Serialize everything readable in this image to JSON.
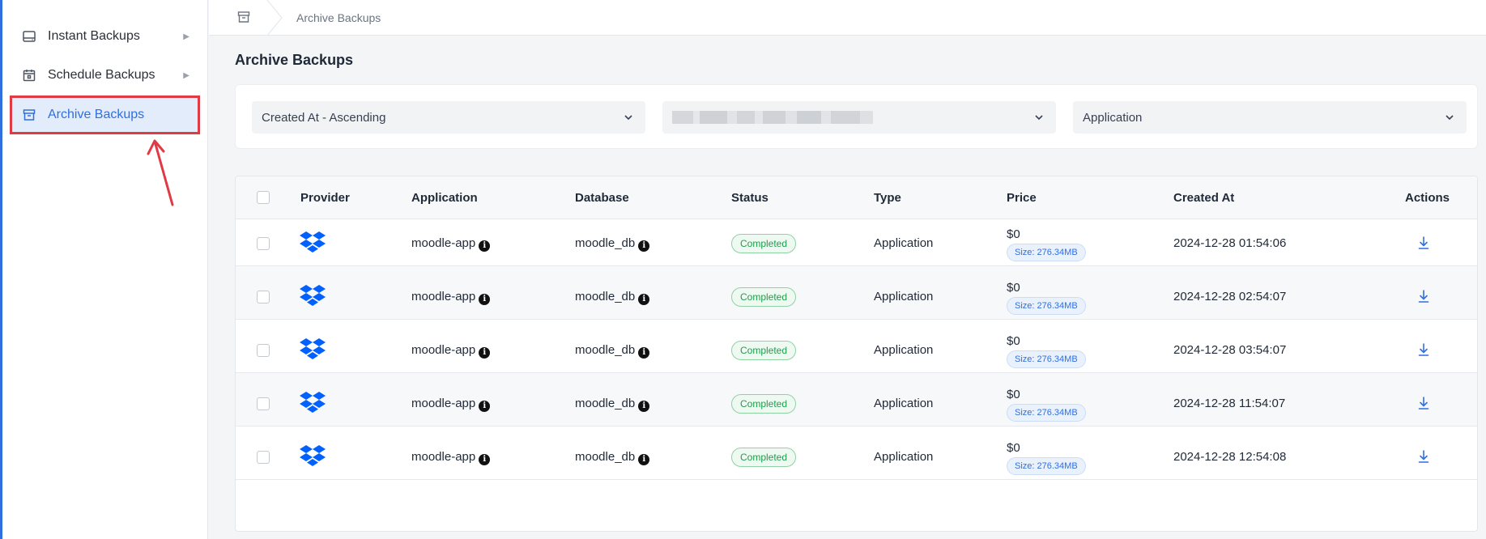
{
  "sidebar": {
    "items": [
      {
        "label": "Instant Backups",
        "icon": "drive-icon",
        "active": false
      },
      {
        "label": "Schedule Backups",
        "icon": "calendar-icon",
        "active": false
      },
      {
        "label": "Archive Backups",
        "icon": "archive-icon",
        "active": true
      }
    ]
  },
  "breadcrumb": {
    "current": "Archive Backups"
  },
  "page": {
    "title": "Archive Backups"
  },
  "filters": {
    "sort": "Created At - Ascending",
    "server": "",
    "type": "Application"
  },
  "table": {
    "columns": [
      "Provider",
      "Application",
      "Database",
      "Status",
      "Type",
      "Price",
      "Created At",
      "Actions"
    ],
    "rows": [
      {
        "provider": "dropbox-icon",
        "application": "moodle-app",
        "database": "moodle_db",
        "status": "Completed",
        "type": "Application",
        "price": "$0",
        "size": "Size: 276.34MB",
        "created_at": "2024-12-28 01:54:06"
      },
      {
        "provider": "dropbox-icon",
        "application": "moodle-app",
        "database": "moodle_db",
        "status": "Completed",
        "type": "Application",
        "price": "$0",
        "size": "Size: 276.34MB",
        "created_at": "2024-12-28 02:54:07"
      },
      {
        "provider": "dropbox-icon",
        "application": "moodle-app",
        "database": "moodle_db",
        "status": "Completed",
        "type": "Application",
        "price": "$0",
        "size": "Size: 276.34MB",
        "created_at": "2024-12-28 03:54:07"
      },
      {
        "provider": "dropbox-icon",
        "application": "moodle-app",
        "database": "moodle_db",
        "status": "Completed",
        "type": "Application",
        "price": "$0",
        "size": "Size: 276.34MB",
        "created_at": "2024-12-28 11:54:07"
      },
      {
        "provider": "dropbox-icon",
        "application": "moodle-app",
        "database": "moodle_db",
        "status": "Completed",
        "type": "Application",
        "price": "$0",
        "size": "Size: 276.34MB",
        "created_at": "2024-12-28 12:54:08"
      }
    ]
  },
  "colors": {
    "accent": "#2f6fe0",
    "highlight": "#e03a44",
    "success": "#1f9d4c",
    "dropbox": "#0061fe"
  }
}
